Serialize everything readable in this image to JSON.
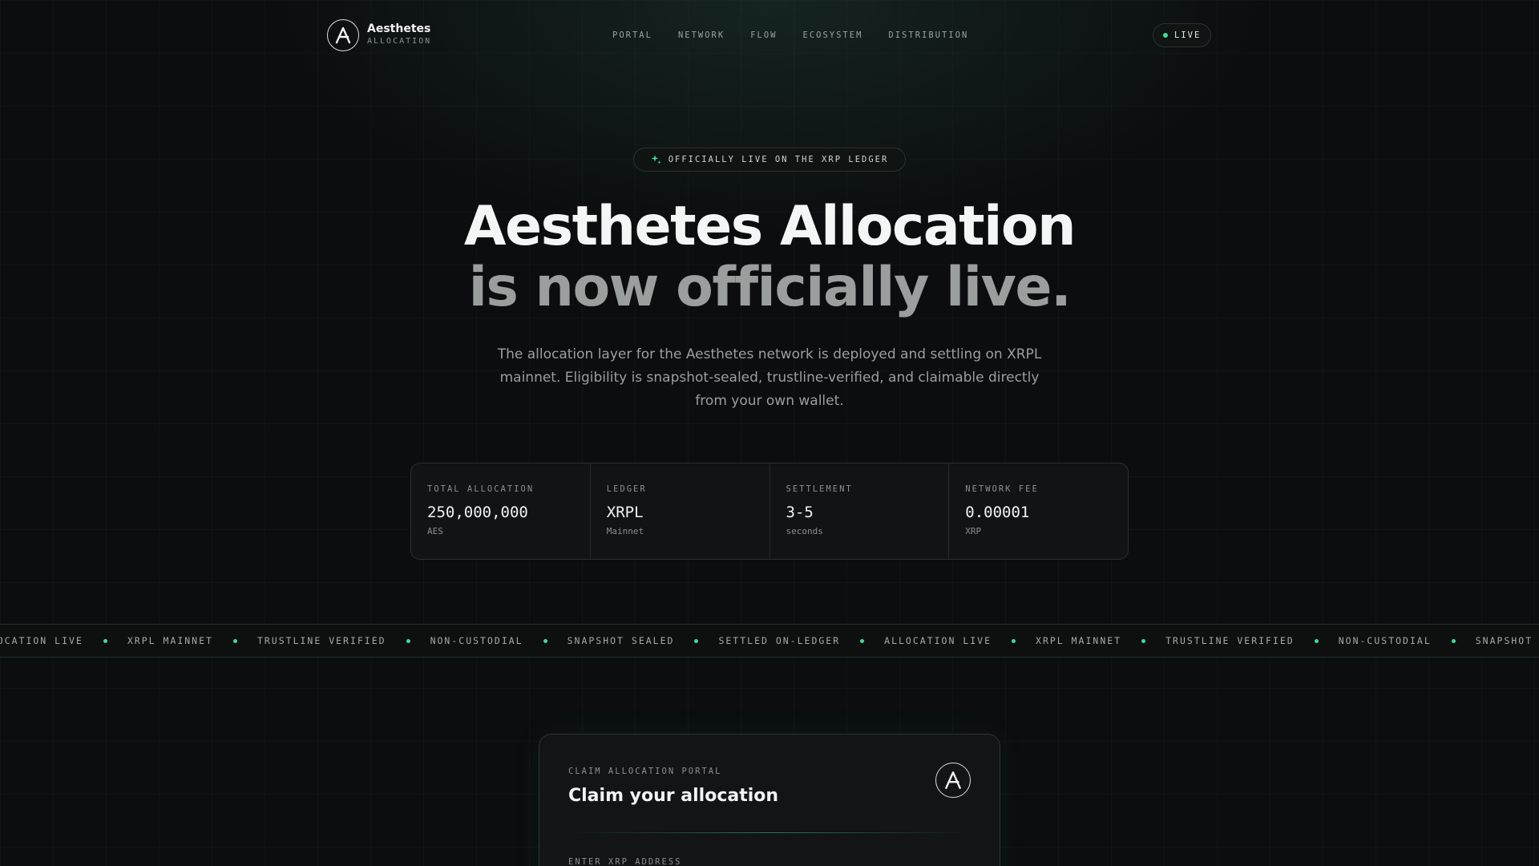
{
  "brand": {
    "name": "Aesthetes",
    "sub": "ALLOCATION"
  },
  "nav": {
    "items": [
      "PORTAL",
      "NETWORK",
      "FLOW",
      "ECOSYSTEM",
      "DISTRIBUTION"
    ]
  },
  "status": {
    "label": "LIVE",
    "color": "#3ddc97"
  },
  "badge": {
    "label": "OFFICIALLY LIVE ON THE XRP LEDGER",
    "icon": "sparkle-icon"
  },
  "hero": {
    "title_line1": "Aesthetes Allocation",
    "title_line2": "is now officially live.",
    "lead": "The allocation layer for the Aesthetes network is deployed and settling on XRPL mainnet. Eligibility is snapshot-sealed, trustline-verified, and claimable directly from your own wallet."
  },
  "stats": [
    {
      "label": "TOTAL ALLOCATION",
      "value": "250,000,000",
      "unit": "AES"
    },
    {
      "label": "LEDGER",
      "value": "XRPL",
      "unit": "Mainnet"
    },
    {
      "label": "SETTLEMENT",
      "value": "3-5",
      "unit": "seconds"
    },
    {
      "label": "NETWORK FEE",
      "value": "0.00001",
      "unit": "XRP"
    }
  ],
  "ticker": {
    "items": [
      "ALLOCATION LIVE",
      "XRPL MAINNET",
      "TRUSTLINE VERIFIED",
      "NON-CUSTODIAL",
      "SNAPSHOT SEALED",
      "SETTLED ON-LEDGER",
      "ALLOCATION LIVE",
      "XRPL MAINNET",
      "TRUSTLINE VERIFIED",
      "NON-CUSTODIAL",
      "SNAPSHOT SEALED"
    ]
  },
  "claim": {
    "kicker": "CLAIM ALLOCATION PORTAL",
    "title": "Claim your allocation",
    "field_label": "ENTER XRP ADDRESS"
  },
  "colors": {
    "accent": "#3ddc97",
    "background": "#0b0d0e"
  }
}
